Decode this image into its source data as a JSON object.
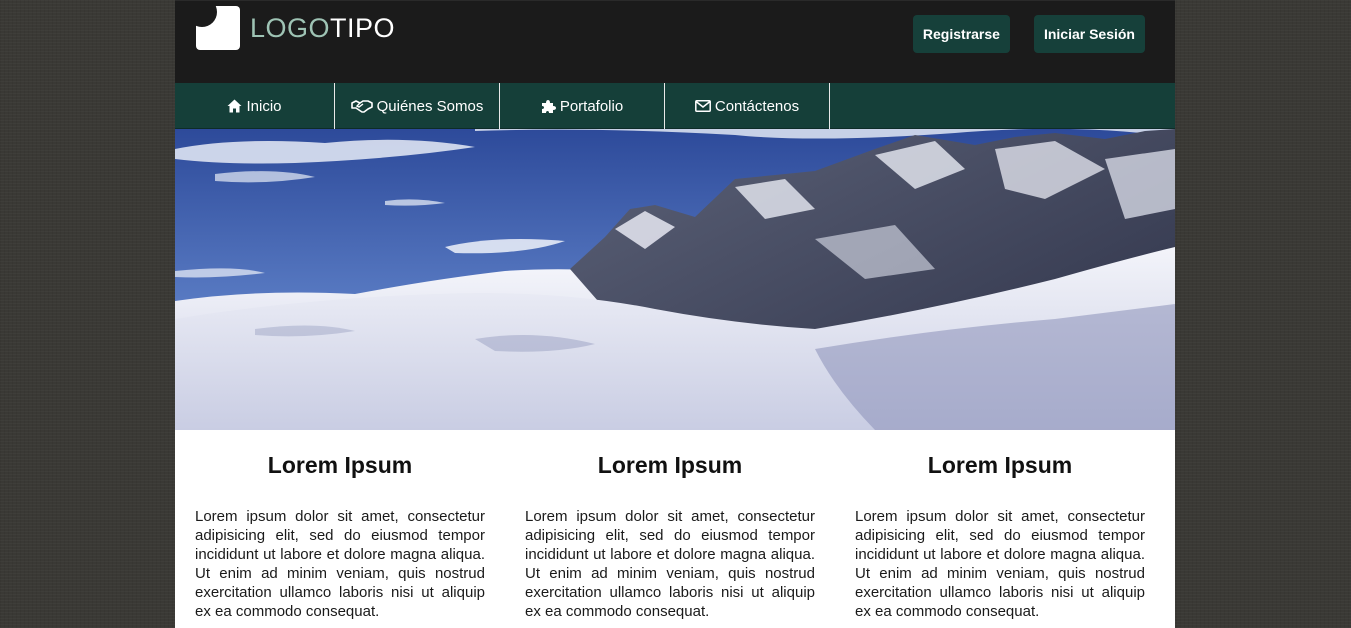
{
  "header": {
    "logo_part1": "LOGO",
    "logo_part2": "TIPO",
    "register_label": "Registrarse",
    "login_label": "Iniciar Sesión"
  },
  "nav": {
    "items": [
      {
        "label": "Inicio",
        "icon": "home-icon"
      },
      {
        "label": "Quiénes Somos",
        "icon": "handshake-icon"
      },
      {
        "label": "Portafolio",
        "icon": "puzzle-icon"
      },
      {
        "label": "Contáctenos",
        "icon": "envelope-icon"
      }
    ]
  },
  "hero": {
    "image": "snowy-mountain-landscape"
  },
  "columns": [
    {
      "title": "Lorem Ipsum",
      "text": "Lorem ipsum dolor sit amet, consectetur adipisicing elit, sed do eiusmod tempor incididunt ut labore et dolore magna aliqua. Ut enim ad minim veniam, quis nostrud exercitation ullamco laboris nisi ut aliquip ex ea commodo consequat."
    },
    {
      "title": "Lorem Ipsum",
      "text": "Lorem ipsum dolor sit amet, consectetur adipisicing elit, sed do eiusmod tempor incididunt ut labore et dolore magna aliqua. Ut enim ad minim veniam, quis nostrud exercitation ullamco laboris nisi ut aliquip ex ea commodo consequat."
    },
    {
      "title": "Lorem Ipsum",
      "text": "Lorem ipsum dolor sit amet, consectetur adipisicing elit, sed do eiusmod tempor incididunt ut labore et dolore magna aliqua. Ut enim ad minim veniam, quis nostrud exercitation ullamco laboris nisi ut aliquip ex ea commodo consequat."
    }
  ],
  "colors": {
    "topbar": "#1b1b1b",
    "nav": "#153f39",
    "button": "#16403a",
    "logo_accent": "#9ec3b4"
  }
}
